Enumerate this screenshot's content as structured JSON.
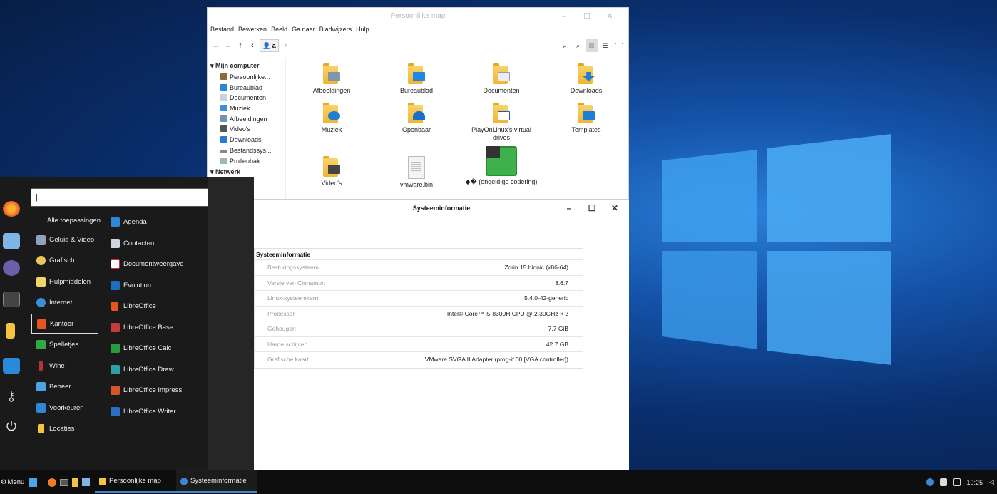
{
  "colors": {
    "desktop_blue": "#1452a8",
    "accent": "#3b87d4",
    "menu_bg": "#1a1a1a"
  },
  "file_manager": {
    "title": "Persoonlijke map",
    "menubar": [
      "Bestand",
      "Bewerken",
      "Beeld",
      "Ga naar",
      "Bladwijzers",
      "Hulp"
    ],
    "path_button": "a",
    "sidebar": {
      "header_computer": "Mijn computer",
      "items": [
        "Persoonlijke...",
        "Bureaublad",
        "Documenten",
        "Muziek",
        "Afbeeldingen",
        "Video's",
        "Downloads",
        "Bestandssys...",
        "Prullenbak"
      ],
      "header_network": "Netwerk"
    },
    "icons": [
      "Afbeeldingen",
      "Bureaublad",
      "Documenten",
      "Downloads",
      "Muziek",
      "Openbaar",
      "PlayOnLinux's virtual drives",
      "Templates",
      "Video's",
      "vmware.bin",
      "◆� (ongeldige codering)"
    ]
  },
  "sysinfo": {
    "title": "Systeeminformatie",
    "section": "Systeeminformatie",
    "rows": [
      {
        "k": "Besturingssysteem",
        "v": "Zorin 15 bionic (x86-64)"
      },
      {
        "k": "Versie van Cinnamon",
        "v": "3.6.7"
      },
      {
        "k": "Linux-systeemkern",
        "v": "5.4.0-42-generic"
      },
      {
        "k": "Processor",
        "v": "Intel© Core™ i5-8300H CPU @ 2.30GHz × 2"
      },
      {
        "k": "Geheugen",
        "v": "7.7 GiB"
      },
      {
        "k": "Harde schijven",
        "v": "42.7 GB"
      },
      {
        "k": "Grafische kaart",
        "v": "VMware SVGA II Adapter (prog-if 00 [VGA controller])"
      }
    ]
  },
  "start_menu": {
    "search_value": "|",
    "categories": [
      "Alle toepassingen",
      "Geluid & Video",
      "Grafisch",
      "Hulpmiddelen",
      "Internet",
      "Kantoor",
      "Spelletjes",
      "Wine",
      "Beheer",
      "Voorkeuren",
      "Locaties"
    ],
    "apps": [
      "Agenda",
      "Contacten",
      "Documentweergave",
      "Evolution",
      "LibreOffice",
      "LibreOffice Base",
      "LibreOffice Calc",
      "LibreOffice Draw",
      "LibreOffice Impress",
      "LibreOffice Writer"
    ]
  },
  "taskbar": {
    "menu_label": "Menu",
    "tasks": [
      "Persoonlijke map",
      "Systeeminformatie"
    ],
    "clock": "10:25"
  }
}
